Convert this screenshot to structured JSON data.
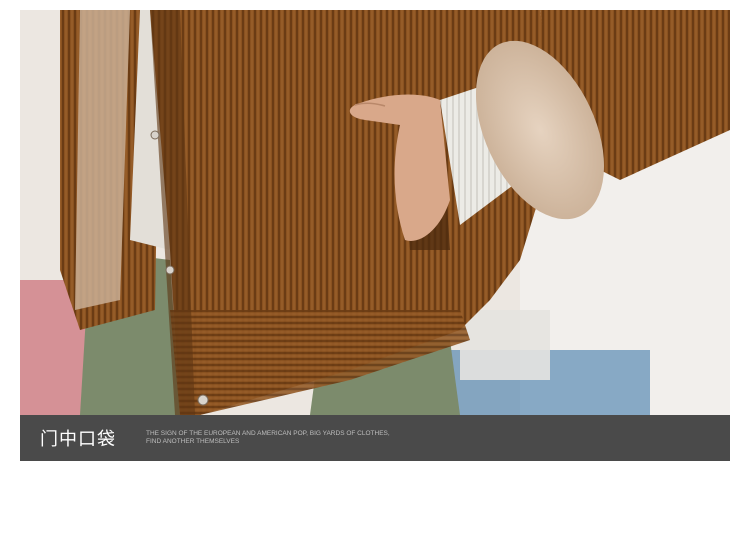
{
  "photo": {
    "subject": "brown corduroy jacket with hand in front pocket",
    "colors": {
      "corduroy": "#8a5220",
      "corduroy_dark": "#5e3512",
      "fur_lining": "#d9c3ad",
      "knit_sleeve": "#ecebe6",
      "pants": "#7c8b6c",
      "skin": "#d9a88a",
      "background": "#ece7e1"
    }
  },
  "caption": {
    "title": "门中口袋",
    "subtitle_line1": "THE SIGN OF THE EUROPEAN AND AMERICAN POP, BIG YARDS OF CLOTHES,",
    "subtitle_line2": "FIND ANOTHER THEMSELVES"
  }
}
